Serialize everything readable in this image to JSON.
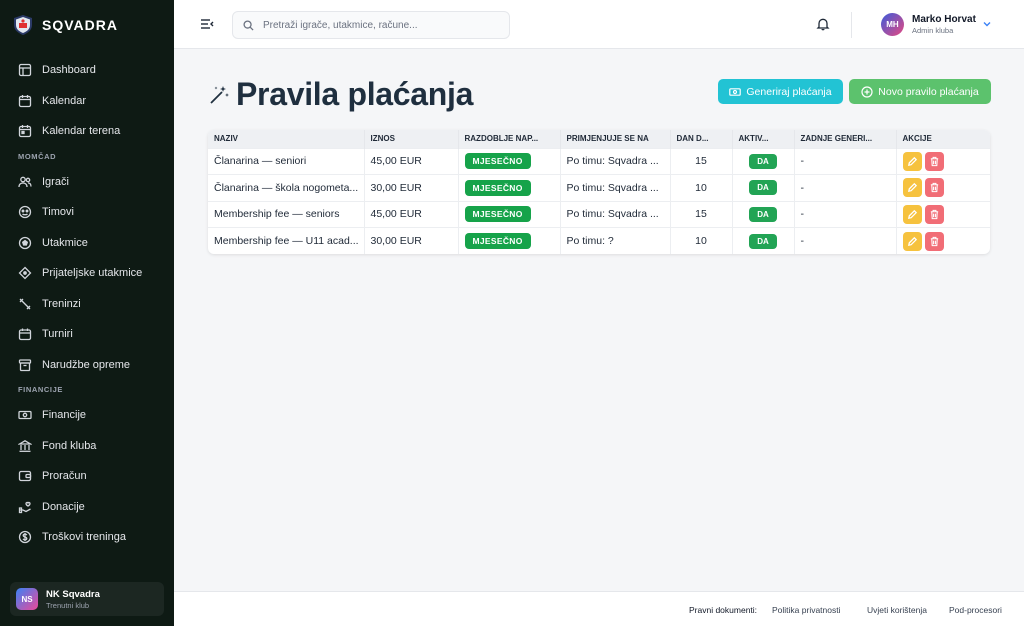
{
  "app": {
    "brand": "SQVADRA"
  },
  "sidebar": {
    "items_top": [
      {
        "label": "Dashboard",
        "icon": "dashboard-icon"
      },
      {
        "label": "Kalendar",
        "icon": "calendar-icon"
      },
      {
        "label": "Kalendar terena",
        "icon": "calendar-field-icon"
      }
    ],
    "section_momcad": "MOMČAD",
    "items_momcad": [
      {
        "label": "Igrači",
        "icon": "players-icon"
      },
      {
        "label": "Timovi",
        "icon": "teams-icon"
      },
      {
        "label": "Utakmice",
        "icon": "football-icon"
      },
      {
        "label": "Prijateljske utakmice",
        "icon": "handshake-icon"
      },
      {
        "label": "Treninzi",
        "icon": "training-icon"
      },
      {
        "label": "Turniri",
        "icon": "tournament-icon"
      },
      {
        "label": "Narudžbe opreme",
        "icon": "equipment-icon"
      }
    ],
    "section_financije": "FINANCIJE",
    "items_financije": [
      {
        "label": "Financije",
        "icon": "money-icon"
      },
      {
        "label": "Fond kluba",
        "icon": "bank-icon"
      },
      {
        "label": "Proračun",
        "icon": "wallet-icon"
      },
      {
        "label": "Donacije",
        "icon": "donation-icon"
      },
      {
        "label": "Troškovi treninga",
        "icon": "dollar-circle-icon"
      }
    ],
    "club": {
      "initials": "NS",
      "name": "NK Sqvadra",
      "subtitle": "Trenutni klub"
    }
  },
  "topbar": {
    "search_placeholder": "Pretraži igrače, utakmice, račune...",
    "user": {
      "initials": "MH",
      "name": "Marko Horvat",
      "role": "Admin kluba"
    }
  },
  "page": {
    "title": "Pravila plaćanja",
    "btn_generate": "Generiraj plaćanja",
    "btn_new": "Novo pravilo plaćanja"
  },
  "table": {
    "headers": [
      "NAZIV",
      "IZNOS",
      "RAZDOBLJE NAP...",
      "PRIMJENJUJE SE NA",
      "DAN D...",
      "AKTIV...",
      "ZADNJE GENERI...",
      "AKCIJE"
    ],
    "rows": [
      {
        "naziv": "Članarina — seniori",
        "iznos": "45,00 EUR",
        "razdoblje": "MJESEČNO",
        "primjena": "Po timu: Sqvadra ...",
        "dan": "15",
        "aktivno": "DA",
        "zadnje": "-"
      },
      {
        "naziv": "Članarina — škola nogometa...",
        "iznos": "30,00 EUR",
        "razdoblje": "MJESEČNO",
        "primjena": "Po timu: Sqvadra ...",
        "dan": "10",
        "aktivno": "DA",
        "zadnje": "-"
      },
      {
        "naziv": "Membership fee — seniors",
        "iznos": "45,00 EUR",
        "razdoblje": "MJESEČNO",
        "primjena": "Po timu: Sqvadra ...",
        "dan": "15",
        "aktivno": "DA",
        "zadnje": "-"
      },
      {
        "naziv": "Membership fee — U11 acad...",
        "iznos": "30,00 EUR",
        "razdoblje": "MJESEČNO",
        "primjena": "Po timu: ?",
        "dan": "10",
        "aktivno": "DA",
        "zadnje": "-"
      }
    ]
  },
  "footer": {
    "label": "Pravni dokumenti:",
    "links": [
      "Politika privatnosti",
      "Uvjeti korištenja",
      "Pod-procesori"
    ]
  },
  "colors": {
    "sidebar_bg": "#0e1a14",
    "accent_cyan": "#22c3d4",
    "accent_green": "#5cc26d",
    "pill_green": "#16a34a",
    "edit_yellow": "#f6c23e",
    "delete_red": "#f16d76"
  }
}
